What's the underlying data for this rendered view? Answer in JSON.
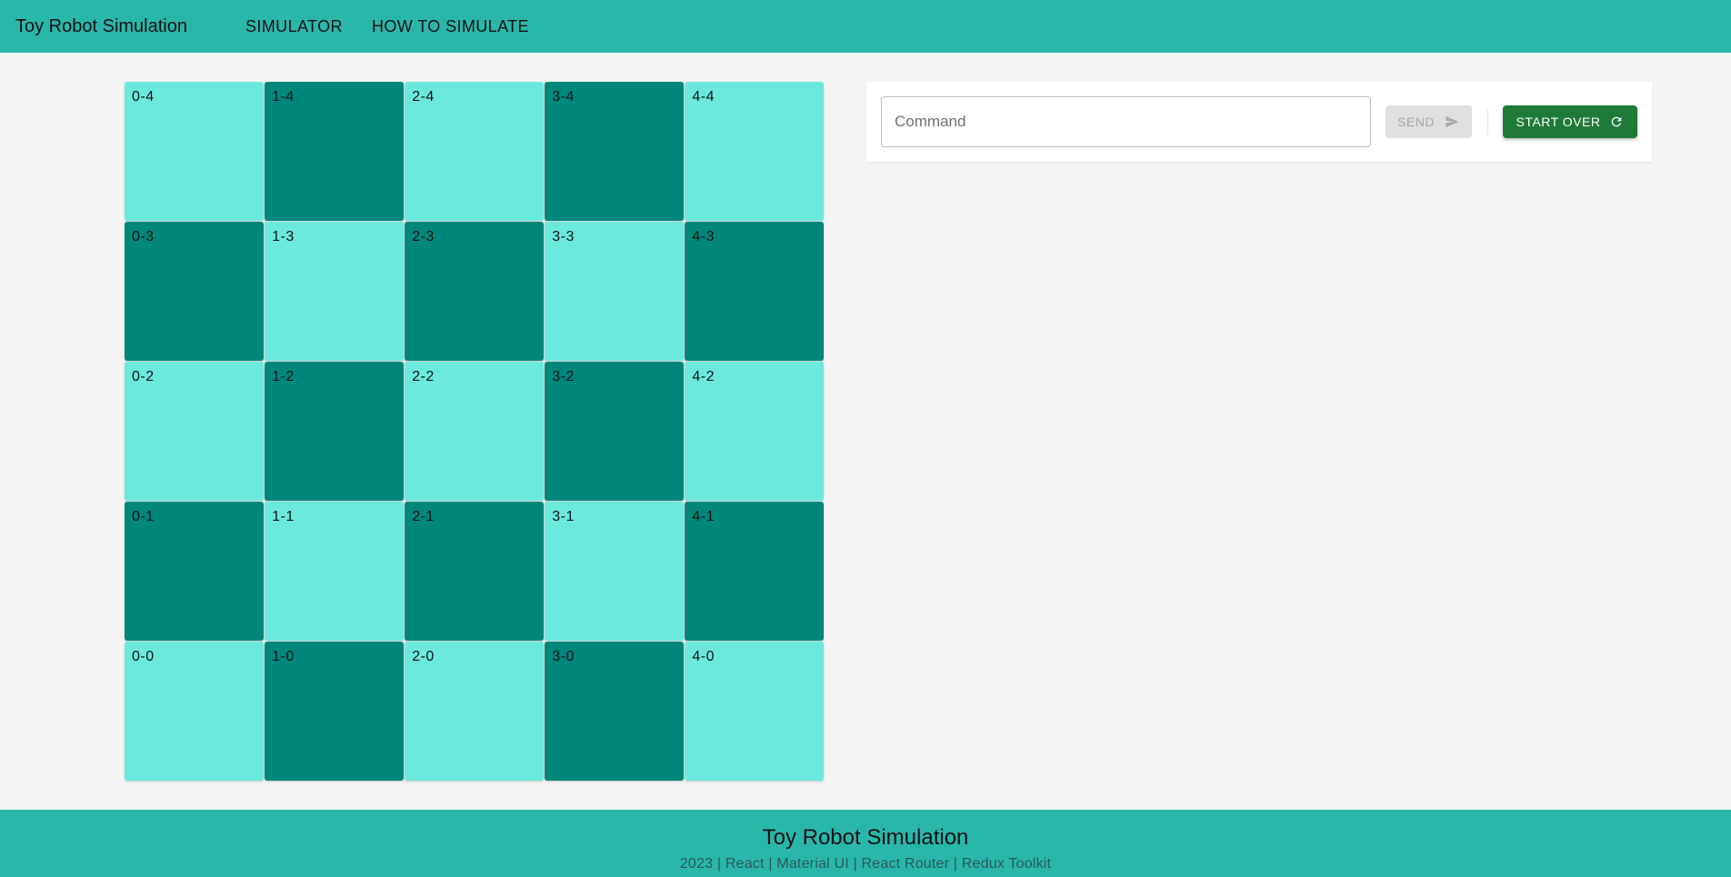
{
  "header": {
    "title": "Toy Robot Simulation",
    "nav": [
      "SIMULATOR",
      "HOW TO SIMULATE"
    ]
  },
  "board": {
    "light_color": "#6ce9df",
    "dark_color": "#00877b",
    "rows": [
      [
        {
          "label": "0-4",
          "shade": "light"
        },
        {
          "label": "1-4",
          "shade": "dark"
        },
        {
          "label": "2-4",
          "shade": "light"
        },
        {
          "label": "3-4",
          "shade": "dark"
        },
        {
          "label": "4-4",
          "shade": "light"
        }
      ],
      [
        {
          "label": "0-3",
          "shade": "dark"
        },
        {
          "label": "1-3",
          "shade": "light"
        },
        {
          "label": "2-3",
          "shade": "dark"
        },
        {
          "label": "3-3",
          "shade": "light"
        },
        {
          "label": "4-3",
          "shade": "dark"
        }
      ],
      [
        {
          "label": "0-2",
          "shade": "light"
        },
        {
          "label": "1-2",
          "shade": "dark"
        },
        {
          "label": "2-2",
          "shade": "light"
        },
        {
          "label": "3-2",
          "shade": "dark"
        },
        {
          "label": "4-2",
          "shade": "light"
        }
      ],
      [
        {
          "label": "0-1",
          "shade": "dark"
        },
        {
          "label": "1-1",
          "shade": "light"
        },
        {
          "label": "2-1",
          "shade": "dark"
        },
        {
          "label": "3-1",
          "shade": "light"
        },
        {
          "label": "4-1",
          "shade": "dark"
        }
      ],
      [
        {
          "label": "0-0",
          "shade": "light"
        },
        {
          "label": "1-0",
          "shade": "dark"
        },
        {
          "label": "2-0",
          "shade": "light"
        },
        {
          "label": "3-0",
          "shade": "dark"
        },
        {
          "label": "4-0",
          "shade": "light"
        }
      ]
    ]
  },
  "controls": {
    "command_placeholder": "Command",
    "command_value": "",
    "send_label": "SEND",
    "send_icon": "send-icon",
    "send_disabled": true,
    "start_over_label": "START OVER",
    "start_over_icon": "refresh-icon",
    "accent_color": "#1e7a36"
  },
  "footer": {
    "title": "Toy Robot Simulation",
    "credits": "2023 | React | Material UI | React Router | Redux Toolkit"
  }
}
